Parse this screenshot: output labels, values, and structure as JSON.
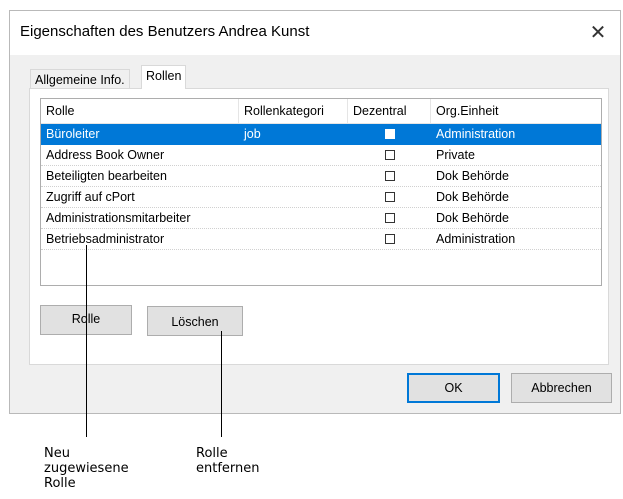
{
  "dialog": {
    "title": "Eigenschaften des Benutzers Andrea Kunst",
    "close_glyph": "✕"
  },
  "tabs": [
    {
      "label": "Allgemeine Info.",
      "active": false
    },
    {
      "label": "Rollen",
      "active": true
    }
  ],
  "table": {
    "columns": [
      "Rolle",
      "Rollenkategori",
      "Dezentral",
      "Org.Einheit"
    ],
    "rows": [
      {
        "rolle": "Büroleiter",
        "kategorie": "job",
        "dezentral": false,
        "org": "Administration",
        "selected": true
      },
      {
        "rolle": "Address Book Owner",
        "kategorie": "",
        "dezentral": false,
        "org": "Private",
        "selected": false
      },
      {
        "rolle": "Beteiligten bearbeiten",
        "kategorie": "",
        "dezentral": false,
        "org": "Dok Behörde",
        "selected": false
      },
      {
        "rolle": "Zugriff auf cPort",
        "kategorie": "",
        "dezentral": false,
        "org": "Dok Behörde",
        "selected": false
      },
      {
        "rolle": "Administrationsmitarbeiter",
        "kategorie": "",
        "dezentral": false,
        "org": "Dok Behörde",
        "selected": false
      },
      {
        "rolle": "Betriebsadministrator",
        "kategorie": "",
        "dezentral": false,
        "org": "Administration",
        "selected": false
      }
    ]
  },
  "buttons": {
    "rolle": "Rolle",
    "loeschen": "Löschen",
    "ok": "OK",
    "abbrechen": "Abbrechen"
  },
  "annotations": {
    "neu": "Neu\nzugewiesene\nRolle",
    "entfernen": "Rolle\nentfernen"
  },
  "colors": {
    "selection": "#0078d7",
    "default_button_border": "#0078d7"
  }
}
